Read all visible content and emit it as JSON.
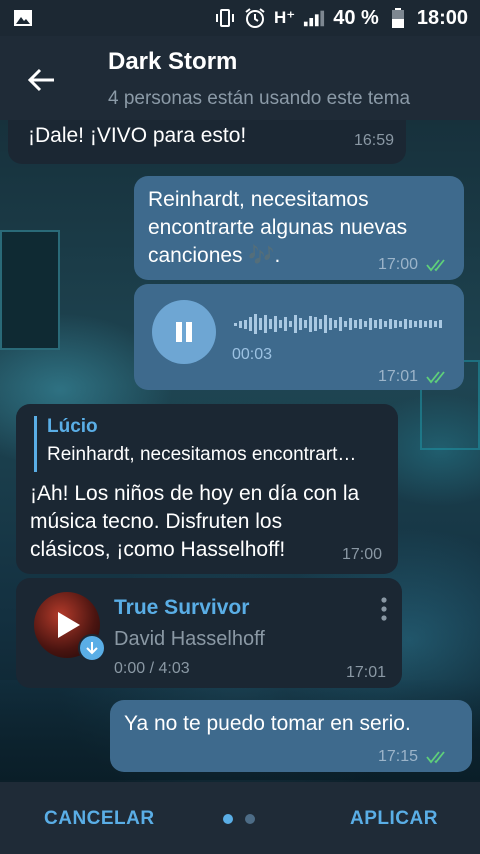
{
  "status_bar": {
    "battery": "40 %",
    "time": "18:00",
    "network": "H⁺"
  },
  "header": {
    "title": "Dark Storm",
    "subtitle": "4 personas están usando este tema"
  },
  "messages": [
    {
      "text": "¡Dale! ¡VIVO para esto!",
      "time": "16:59"
    },
    {
      "text": "Reinhardt, necesitamos encontrarte algunas nuevas canciones 🎶.",
      "time": "17:00"
    },
    {
      "voice_duration": "00:03",
      "time": "17:01"
    },
    {
      "reply_author": "Lúcio",
      "reply_text": "Reinhardt, necesitamos encontrart…",
      "text": "¡Ah! Los niños de hoy en día con la música tecno. Disfruten los clásicos, ¡como Hasselhoff!",
      "time": "17:00"
    },
    {
      "song_title": "True Survivor",
      "song_artist": "David Hasselhoff",
      "song_progress": "0:00 / 4:03",
      "time": "17:01"
    },
    {
      "text": "Ya no te puedo tomar en serio.",
      "time": "17:15"
    }
  ],
  "bottom_bar": {
    "cancel_label": "CANCELAR",
    "apply_label": "APLICAR",
    "page_count": 2,
    "active_page": 1
  },
  "colors": {
    "accent": "#5aaee6",
    "outgoing_bubble": "#3e6a8d",
    "incoming_bubble": "#1b2733",
    "check_green": "#5fd07a"
  }
}
